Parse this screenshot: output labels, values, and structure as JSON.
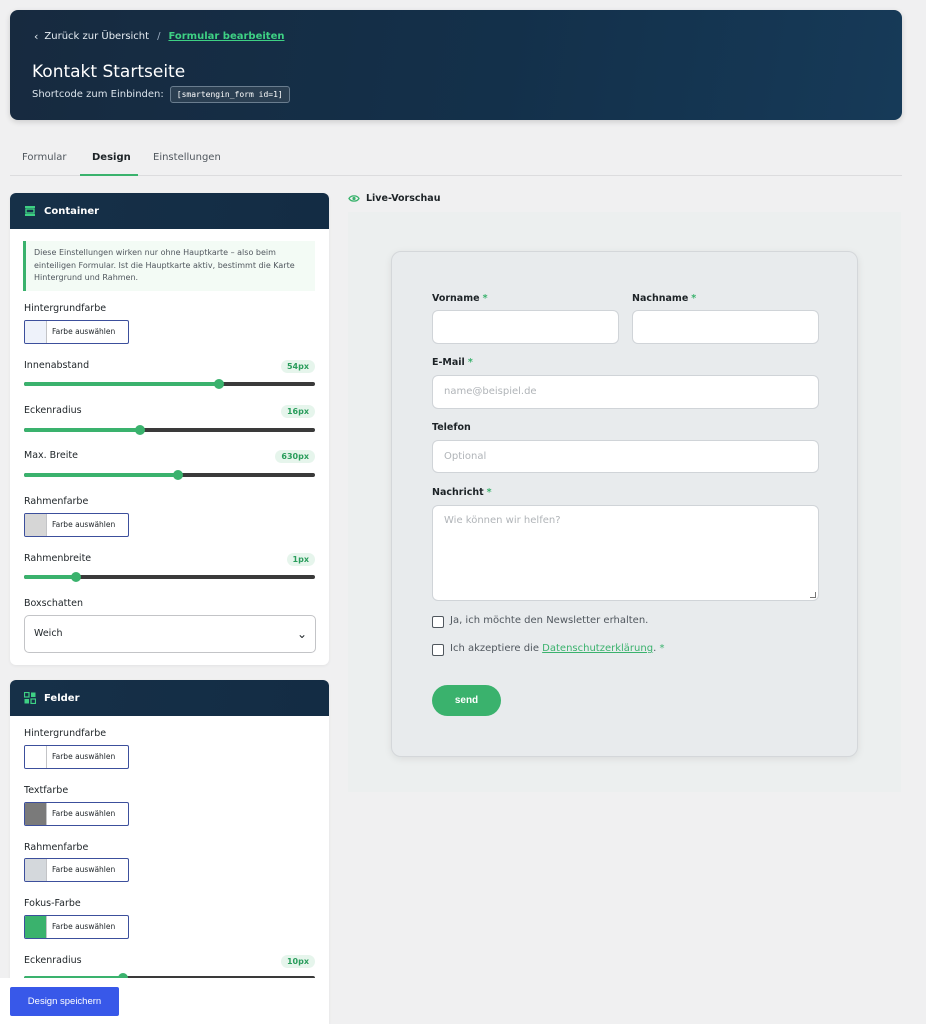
{
  "header": {
    "back_label": "Zurück zur Übersicht",
    "current_crumb": "Formular bearbeiten",
    "title": "Kontakt Startseite",
    "shortcode_label": "Shortcode zum Einbinden:",
    "shortcode": "[smartengin_form id=1]"
  },
  "tabs": [
    "Formular",
    "Design",
    "Einstellungen"
  ],
  "container_panel": {
    "title": "Container",
    "notice": "Diese Einstellungen wirken nur ohne Hauptkarte – also beim einteiligen Formular. Ist die Hauptkarte aktiv, bestimmt die Karte Hintergrund und Rahmen.",
    "bg_label": "Hintergrundfarbe",
    "bg_color": "#eef2fa",
    "pick_label": "Farbe auswählen",
    "padding_label": "Innenabstand",
    "padding_value": "54px",
    "padding_level": 0.67,
    "radius_label": "Eckenradius",
    "radius_value": "16px",
    "radius_level": 0.4,
    "maxwidth_label": "Max. Breite",
    "maxwidth_value": "630px",
    "maxwidth_level": 0.53,
    "border_color_label": "Rahmenfarbe",
    "border_color": "#d6d6d6",
    "border_width_label": "Rahmenbreite",
    "border_width_value": "1px",
    "border_width_level": 0.18,
    "shadow_label": "Boxschatten",
    "shadow_value": "Weich"
  },
  "fields_panel": {
    "title": "Felder",
    "bg_label": "Hintergrundfarbe",
    "bg_color": "#ffffff",
    "text_label": "Textfarbe",
    "text_color": "#7a7a7a",
    "border_label": "Rahmenfarbe",
    "border_color": "#d4d8dc",
    "focus_label": "Fokus-Farbe",
    "focus_color": "#3ab26d",
    "pick_label": "Farbe auswählen",
    "radius_label": "Eckenradius",
    "radius_value": "10px",
    "radius_level": 0.34
  },
  "save_label": "Design speichern",
  "preview": {
    "label": "Live-Vorschau",
    "vorname": "Vorname",
    "nachname": "Nachname",
    "email": "E-Mail",
    "email_placeholder": "name@beispiel.de",
    "telefon": "Telefon",
    "telefon_placeholder": "Optional",
    "nachricht": "Nachricht",
    "nachricht_placeholder": "Wie können wir helfen?",
    "newsletter": "Ja, ich möchte den Newsletter erhalten.",
    "privacy_pre": "Ich akzeptiere die",
    "privacy_link": "Datenschutzerklärung",
    "privacy_post": ".",
    "required_mark": "*",
    "send": "send"
  },
  "colors": {
    "accent": "#3ab26d",
    "primary_button": "#3858e9",
    "header_bg": "#172a3f"
  }
}
